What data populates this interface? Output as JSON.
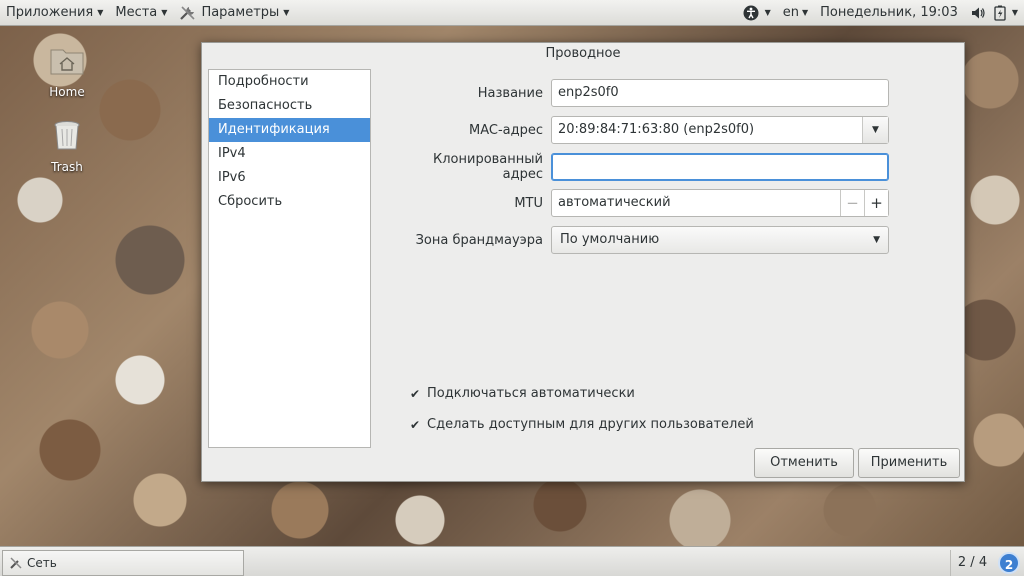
{
  "topbar": {
    "applications": "Приложения",
    "places": "Места",
    "app_name": "Параметры",
    "keyboard_layout": "en",
    "datetime": "Понедельник, 19:03"
  },
  "desktop": {
    "home_label": "Home",
    "trash_label": "Trash"
  },
  "dialog": {
    "title": "Проводное",
    "sidebar": [
      {
        "label": "Подробности",
        "selected": false
      },
      {
        "label": "Безопасность",
        "selected": false
      },
      {
        "label": "Идентификация",
        "selected": true
      },
      {
        "label": "IPv4",
        "selected": false
      },
      {
        "label": "IPv6",
        "selected": false
      },
      {
        "label": "Сбросить",
        "selected": false
      }
    ],
    "form": {
      "name_label": "Название",
      "name_value": "enp2s0f0",
      "mac_label": "MAC-адрес",
      "mac_value": "20:89:84:71:63:80 (enp2s0f0)",
      "cloned_label": "Клонированный адрес",
      "cloned_value": "",
      "mtu_label": "MTU",
      "mtu_value": "автоматический",
      "mtu_minus": "−",
      "mtu_plus": "+",
      "firewall_label": "Зона брандмауэра",
      "firewall_value": "По умолчанию"
    },
    "checks": {
      "auto_connect": {
        "label": "Подключаться автоматически",
        "checked": true
      },
      "all_users": {
        "label": "Сделать доступным для других пользователей",
        "checked": true
      }
    },
    "buttons": {
      "cancel": "Отменить",
      "apply": "Применить"
    }
  },
  "bottombar": {
    "task_label": "Сеть",
    "workspace": "2 / 4",
    "notification_count": "2"
  },
  "colors": {
    "selection": "#4a90d9",
    "focus": "#4a90d9",
    "notification": "#3d7fd1"
  }
}
